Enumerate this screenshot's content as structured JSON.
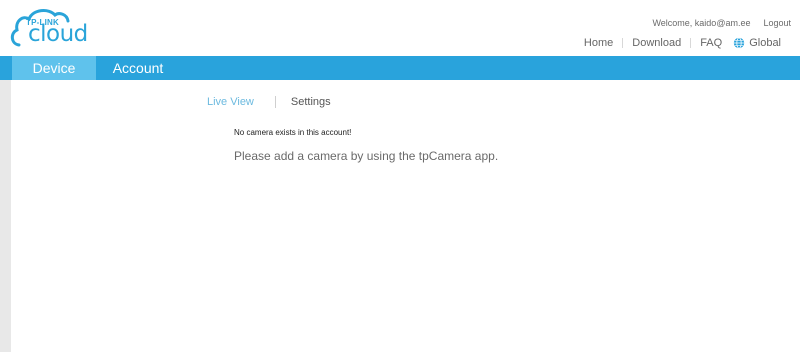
{
  "logo": {
    "top_text": "TP-LINK",
    "word": "cloud"
  },
  "header": {
    "welcome": "Welcome, kaido@am.ee",
    "logout": "Logout",
    "links": [
      "Home",
      "Download",
      "FAQ"
    ],
    "region": "Global"
  },
  "nav": {
    "tabs": [
      "Device",
      "Account"
    ],
    "active": "Device"
  },
  "subtabs": {
    "live_view": "Live View",
    "settings": "Settings"
  },
  "content": {
    "no_camera": "No camera exists in this account!",
    "instruction": "Please add a camera by using the tpCamera app."
  },
  "colors": {
    "accent": "#29a3dc",
    "active_tab": "#5fc2ec",
    "sidebar": "#e8e8e8"
  },
  "icons": [
    "cloud-logo-icon",
    "globe-icon"
  ]
}
